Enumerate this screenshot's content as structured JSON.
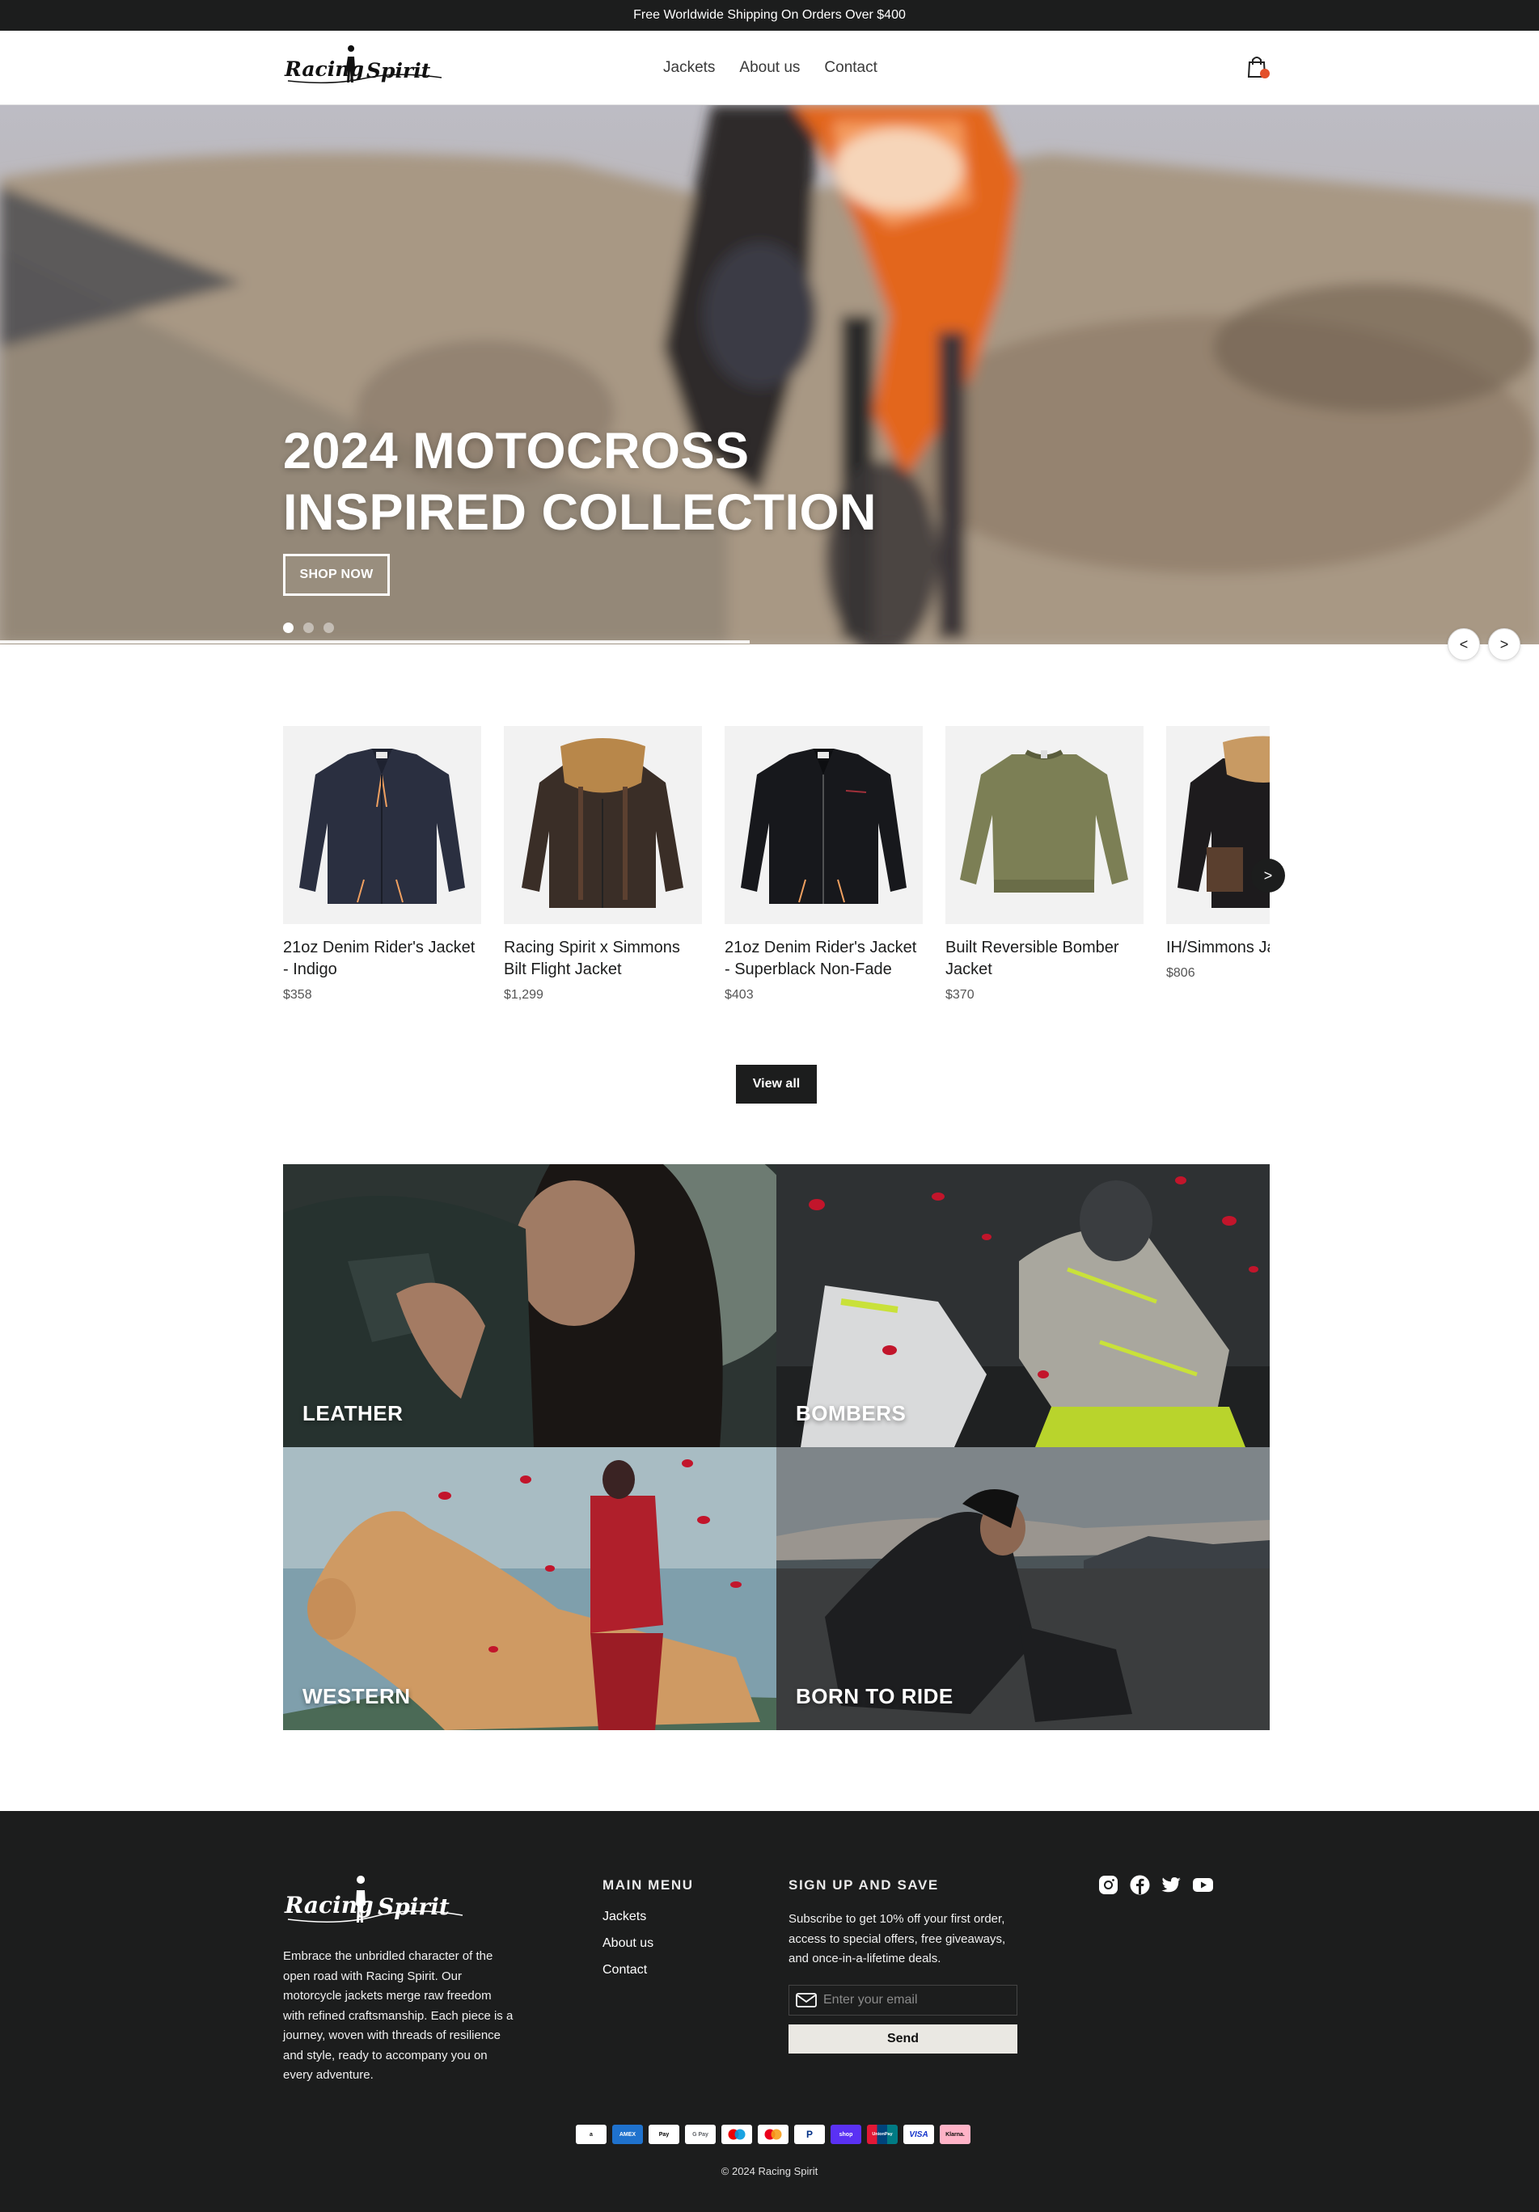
{
  "announcement": "Free Worldwide Shipping On Orders Over $400",
  "brand": {
    "name": "Racing Spirit"
  },
  "nav": {
    "items": [
      "Jackets",
      "About us",
      "Contact"
    ]
  },
  "hero": {
    "title_line1": "2024 MOTOCROSS",
    "title_line2": "INSPIRED COLLECTION",
    "button": "SHOP NOW",
    "slides": 3,
    "active_slide": 1,
    "prev": "<",
    "next": ">"
  },
  "products": [
    {
      "title": "21oz Denim Rider's Jacket - Indigo",
      "price": "$358"
    },
    {
      "title": "Racing Spirit x Simmons Bilt Flight Jacket",
      "price": "$1,299"
    },
    {
      "title": "21oz Denim Rider's Jacket - Superblack Non-Fade",
      "price": "$403"
    },
    {
      "title": "Built Reversible Bomber Jacket",
      "price": "$370"
    },
    {
      "title": "IH/Simmons Jacket",
      "price": "$806"
    }
  ],
  "products_next": ">",
  "view_all": "View all",
  "collections": [
    {
      "label": "LEATHER"
    },
    {
      "label": "BOMBERS"
    },
    {
      "label": "WESTERN"
    },
    {
      "label": "BORN TO RIDE"
    }
  ],
  "footer": {
    "about": "Embrace the unbridled character of the open road with Racing Spirit. Our motorcycle jackets merge raw freedom with refined craftsmanship. Each piece is a journey, woven with threads of resilience and style, ready to accompany you on every adventure.",
    "menu_heading": "MAIN MENU",
    "menu": [
      "Jackets",
      "About us",
      "Contact"
    ],
    "signup_heading": "SIGN UP AND SAVE",
    "signup_text": "Subscribe to get 10% off your first order, access to special offers, free giveaways, and once-in-a-lifetime deals.",
    "email_placeholder": "Enter your email",
    "send": "Send",
    "socials": [
      "instagram-icon",
      "facebook-icon",
      "twitter-icon",
      "youtube-icon"
    ],
    "payments": [
      {
        "name": "Amazon",
        "label": "a",
        "bg": "#ffffff",
        "fg": "#111111"
      },
      {
        "name": "American Express",
        "label": "AMEX",
        "bg": "#1f72cd",
        "fg": "#ffffff"
      },
      {
        "name": "Apple Pay",
        "label": "Pay",
        "bg": "#ffffff",
        "fg": "#000000"
      },
      {
        "name": "Google Pay",
        "label": "G Pay",
        "bg": "#ffffff",
        "fg": "#5f6368"
      },
      {
        "name": "Maestro",
        "label": "",
        "bg": "#ffffff",
        "fg": "#000000"
      },
      {
        "name": "Mastercard",
        "label": "",
        "bg": "#ffffff",
        "fg": "#000000"
      },
      {
        "name": "PayPal",
        "label": "P",
        "bg": "#ffffff",
        "fg": "#003087"
      },
      {
        "name": "Shop Pay",
        "label": "shop",
        "bg": "#5a31f4",
        "fg": "#ffffff"
      },
      {
        "name": "Union Pay",
        "label": "UnionPay",
        "bg": "#e21836",
        "fg": "#ffffff"
      },
      {
        "name": "Visa",
        "label": "VISA",
        "bg": "#ffffff",
        "fg": "#1434cb"
      },
      {
        "name": "Klarna",
        "label": "Klarna.",
        "bg": "#ffb3c7",
        "fg": "#0a0b09"
      }
    ],
    "copyright": "© 2024 Racing Spirit"
  },
  "colors": {
    "announcement_bg": "#1c1d1d",
    "footer_bg": "#1c1d1d",
    "cart_dot": "#e3502a",
    "send_bg": "#eae8e3"
  }
}
